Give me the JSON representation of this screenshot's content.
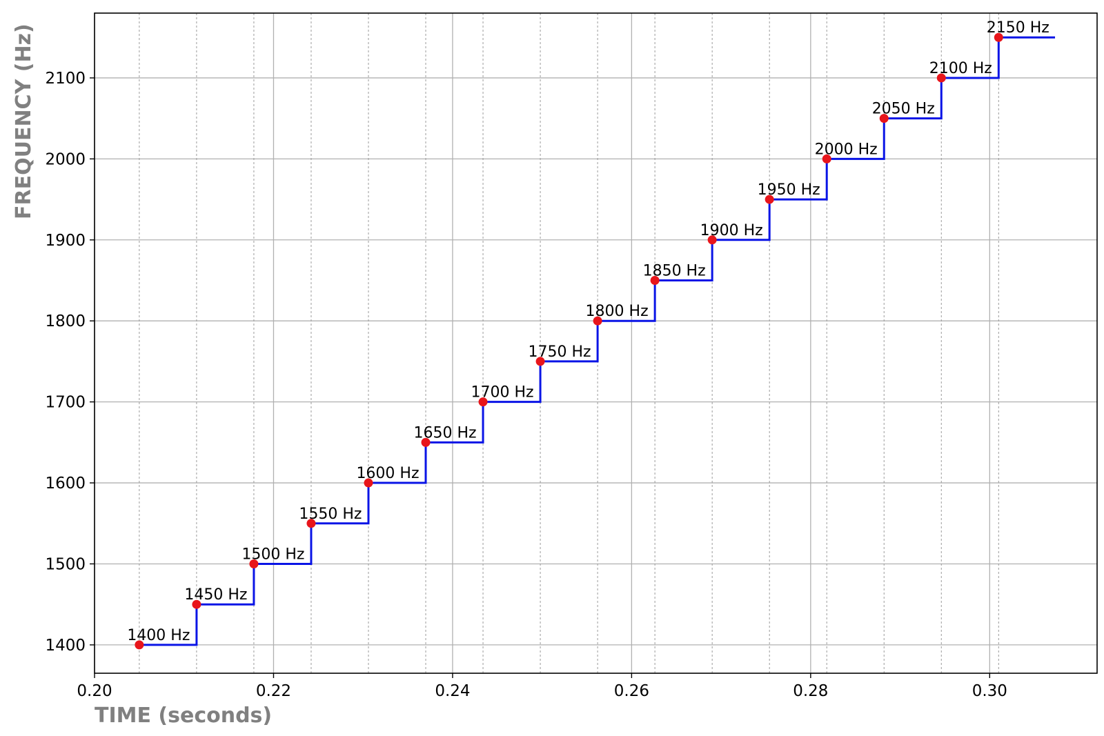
{
  "chart_data": {
    "type": "line",
    "subtype": "step",
    "title": "",
    "xlabel": "TIME (seconds)",
    "ylabel": "FREQUENCY (Hz)",
    "xlim": [
      0.2,
      0.312
    ],
    "ylim": [
      1365,
      2180
    ],
    "x_ticks": [
      0.2,
      0.22,
      0.24,
      0.26,
      0.28,
      0.3
    ],
    "x_tick_labels": [
      "0.20",
      "0.22",
      "0.24",
      "0.26",
      "0.28",
      "0.30"
    ],
    "y_ticks": [
      1400,
      1500,
      1600,
      1700,
      1800,
      1900,
      2000,
      2100
    ],
    "y_tick_labels": [
      "1400",
      "1500",
      "1600",
      "1700",
      "1800",
      "1900",
      "2000",
      "2100"
    ],
    "grid": true,
    "step_end_x": 0.3073,
    "points": [
      {
        "x": 0.205,
        "y": 1400,
        "label": "1400 Hz"
      },
      {
        "x": 0.2114,
        "y": 1450,
        "label": "1450 Hz"
      },
      {
        "x": 0.2178,
        "y": 1500,
        "label": "1500 Hz"
      },
      {
        "x": 0.2242,
        "y": 1550,
        "label": "1550 Hz"
      },
      {
        "x": 0.2306,
        "y": 1600,
        "label": "1600 Hz"
      },
      {
        "x": 0.237,
        "y": 1650,
        "label": "1650 Hz"
      },
      {
        "x": 0.2434,
        "y": 1700,
        "label": "1700 Hz"
      },
      {
        "x": 0.2498,
        "y": 1750,
        "label": "1750 Hz"
      },
      {
        "x": 0.2562,
        "y": 1800,
        "label": "1800 Hz"
      },
      {
        "x": 0.2626,
        "y": 1850,
        "label": "1850 Hz"
      },
      {
        "x": 0.269,
        "y": 1900,
        "label": "1900 Hz"
      },
      {
        "x": 0.2754,
        "y": 1950,
        "label": "1950 Hz"
      },
      {
        "x": 0.2818,
        "y": 2000,
        "label": "2000 Hz"
      },
      {
        "x": 0.2882,
        "y": 2050,
        "label": "2050 Hz"
      },
      {
        "x": 0.2946,
        "y": 2100,
        "label": "2100 Hz"
      },
      {
        "x": 0.301,
        "y": 2150,
        "label": "2150 Hz"
      }
    ],
    "colors": {
      "line": "#0a14e6",
      "marker": "#e8151b",
      "grid": "#b0b0b0",
      "axis_title": "#808080"
    }
  }
}
